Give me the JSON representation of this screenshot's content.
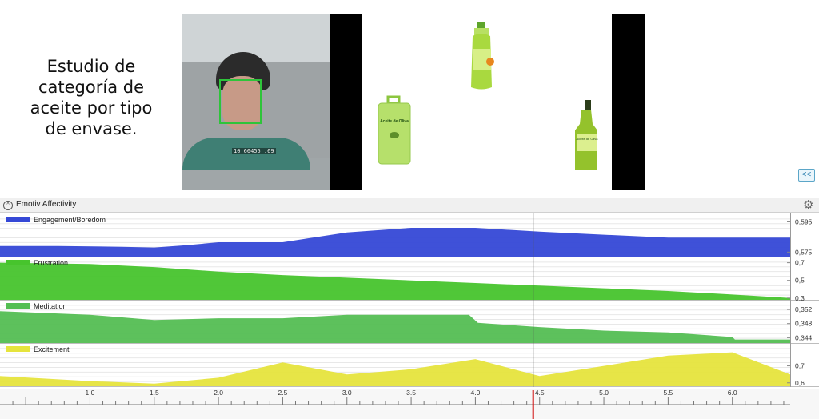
{
  "caption": {
    "line1": "Estudio de",
    "line2": "categoría de",
    "line3": "aceite por tipo",
    "line4": "de envase."
  },
  "webcam": {
    "timecode": "10:60455 .69"
  },
  "stimulus": {
    "canister_label": "Aceite de Oliva",
    "bottle_label": "Aceite de Oliva"
  },
  "collapse_button": {
    "label": "<<"
  },
  "panel": {
    "title": "Emotiv Affectivity",
    "toggle": "^"
  },
  "colors": {
    "engagement": "#3548d6",
    "frustration": "#47c42d",
    "meditation": "#54be53",
    "excitement": "#e6e43d",
    "cursor": "#d01010",
    "playhead": "#555555"
  },
  "chart_data": [
    {
      "type": "area",
      "name": "Engagement/Boredom",
      "x": [
        0.3,
        0.75,
        1.25,
        1.5,
        1.75,
        2.0,
        2.5,
        3.0,
        3.5,
        4.0,
        4.5,
        5.0,
        5.5,
        6.0,
        6.45
      ],
      "y": [
        0.579,
        0.579,
        0.5785,
        0.578,
        0.5795,
        0.5815,
        0.5815,
        0.588,
        0.591,
        0.591,
        0.5885,
        0.5865,
        0.5845,
        0.5845,
        0.5845
      ],
      "yticks": [
        "0,595",
        "0,575"
      ],
      "ylim": [
        0.572,
        0.6
      ]
    },
    {
      "type": "area",
      "name": "Frustration",
      "x": [
        0.3,
        1.0,
        1.5,
        2.0,
        2.5,
        3.0,
        3.5,
        4.0,
        4.5,
        5.0,
        5.5,
        6.0,
        6.45
      ],
      "y": [
        0.7,
        0.685,
        0.65,
        0.6,
        0.56,
        0.53,
        0.5,
        0.47,
        0.44,
        0.41,
        0.38,
        0.34,
        0.3
      ],
      "yticks": [
        "0,7",
        "0,5",
        "0,3"
      ],
      "ylim": [
        0.28,
        0.76
      ]
    },
    {
      "type": "area",
      "name": "Meditation",
      "x": [
        0.3,
        1.0,
        1.5,
        2.0,
        2.5,
        3.0,
        3.5,
        3.95,
        4.02,
        4.5,
        5.0,
        5.5,
        6.0,
        6.02,
        6.45
      ],
      "y": [
        0.3515,
        0.3505,
        0.349,
        0.3495,
        0.3495,
        0.3505,
        0.3505,
        0.3505,
        0.3482,
        0.347,
        0.346,
        0.3455,
        0.3442,
        0.3435,
        0.3435
      ],
      "yticks": [
        "0,352",
        "0,348",
        "0,344"
      ],
      "ylim": [
        0.3425,
        0.3545
      ]
    },
    {
      "type": "area",
      "name": "Excitement",
      "x": [
        0.3,
        1.0,
        1.5,
        2.0,
        2.5,
        3.0,
        3.5,
        4.0,
        4.5,
        5.0,
        5.5,
        6.0,
        6.45
      ],
      "y": [
        0.64,
        0.61,
        0.595,
        0.63,
        0.72,
        0.65,
        0.68,
        0.74,
        0.64,
        0.7,
        0.76,
        0.78,
        0.65
      ],
      "yticks": [
        "0,7",
        "0,6"
      ],
      "ylim": [
        0.58,
        0.83
      ]
    }
  ],
  "time_axis": {
    "ticks": [
      "1.0",
      "1.5",
      "2.0",
      "2.5",
      "3.0",
      "3.5",
      "4.0",
      "4.5",
      "5.0",
      "5.5",
      "6.0"
    ],
    "xlim": [
      0.3,
      6.45
    ],
    "cursor_time": 4.45
  }
}
